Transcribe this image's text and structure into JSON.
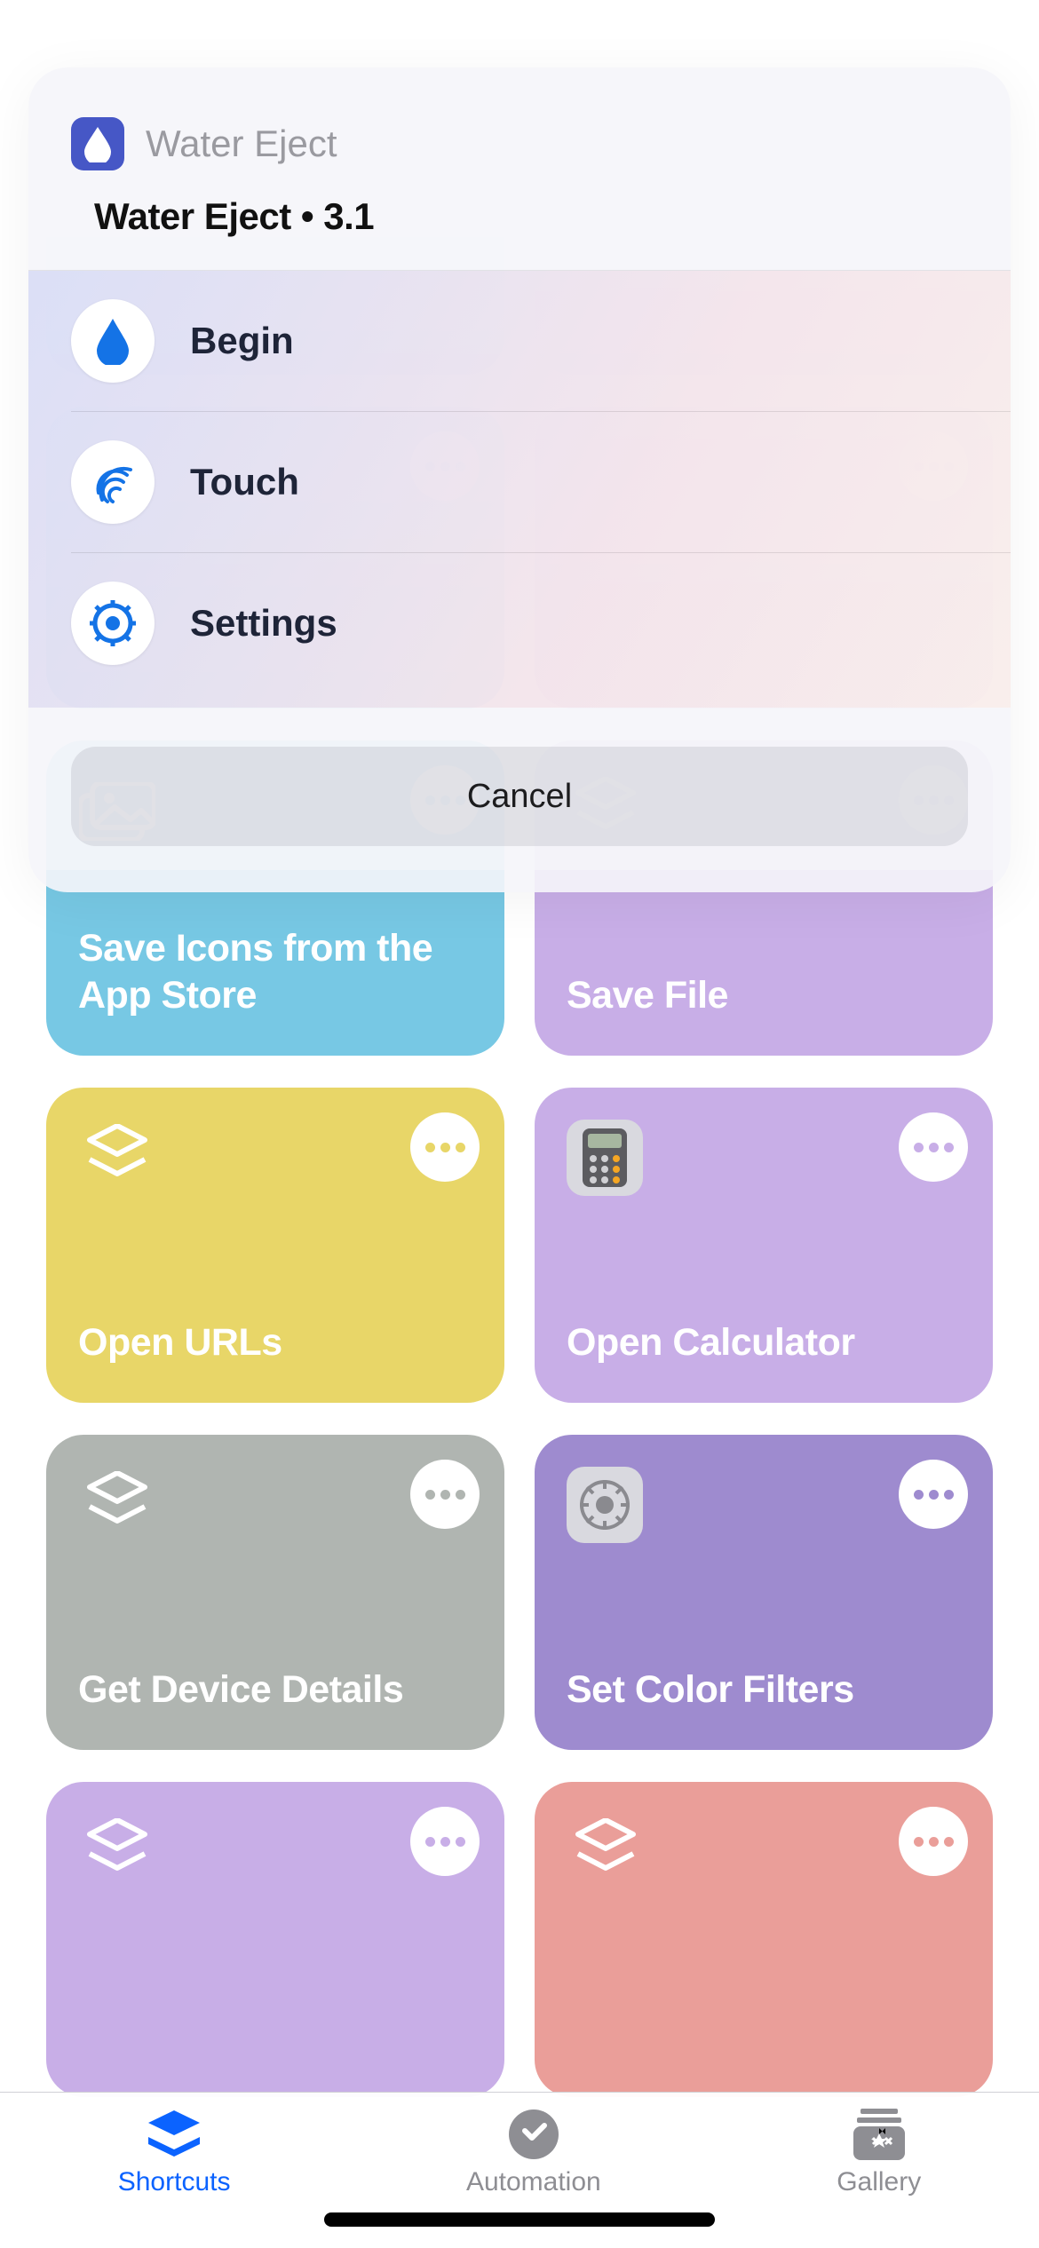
{
  "sheet": {
    "app_name": "Water Eject",
    "title": "Water Eject  •  3.1",
    "options": [
      {
        "label": "Begin",
        "icon": "water-drop-icon"
      },
      {
        "label": "Touch",
        "icon": "fingerprint-icon"
      },
      {
        "label": "Settings",
        "icon": "gear-icon"
      }
    ],
    "cancel_label": "Cancel"
  },
  "shortcuts": [
    {
      "title": "",
      "color": "teal",
      "icon": "shortcut-icon"
    },
    {
      "title": "",
      "color": "lav",
      "icon": "shortcut-icon"
    },
    {
      "title": "Save Icons from the App Store",
      "color": "teal",
      "icon": "photos-icon"
    },
    {
      "title": "Save File",
      "color": "lav",
      "icon": "shortcut-icon"
    },
    {
      "title": "Open URLs",
      "color": "yel",
      "icon": "shortcut-icon"
    },
    {
      "title": "Open Calculator",
      "color": "lav",
      "icon": "calculator-app-icon"
    },
    {
      "title": "Get Device Details",
      "color": "gray",
      "icon": "shortcut-icon"
    },
    {
      "title": "Set Color Filters",
      "color": "purp",
      "icon": "settings-app-icon"
    },
    {
      "title": "",
      "color": "lav",
      "icon": "shortcut-icon"
    },
    {
      "title": "",
      "color": "pink",
      "icon": "shortcut-icon"
    }
  ],
  "tabs": {
    "shortcuts": "Shortcuts",
    "automation": "Automation",
    "gallery": "Gallery"
  }
}
